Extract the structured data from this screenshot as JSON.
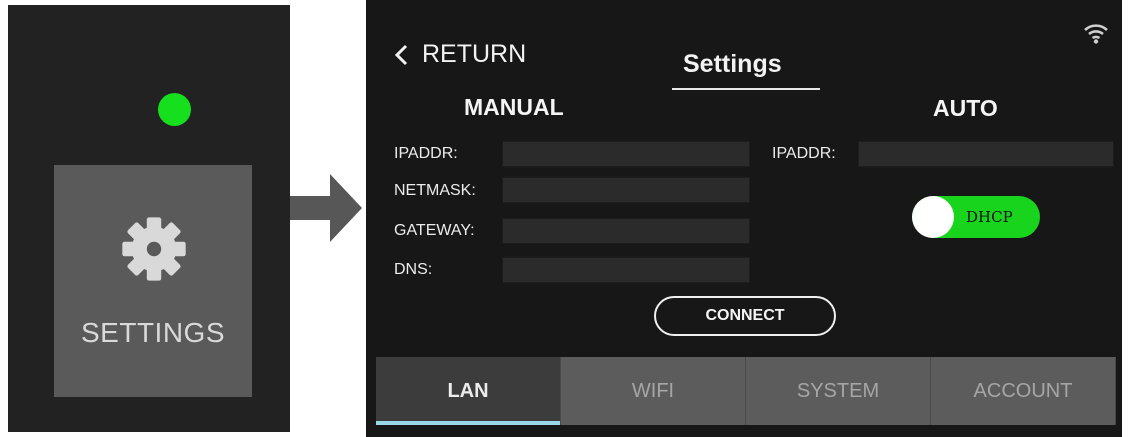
{
  "left_panel": {
    "status_color": "#16e01e",
    "tile_label": "SETTINGS",
    "tile_icon": "gear-icon"
  },
  "arrow_icon": "arrow-right-icon",
  "settings_screen": {
    "return_label": "RETURN",
    "title": "Settings",
    "status_icon": "wifi-icon",
    "manual": {
      "title": "MANUAL",
      "fields": [
        {
          "label": "IPADDR:",
          "value": ""
        },
        {
          "label": "NETMASK:",
          "value": ""
        },
        {
          "label": "GATEWAY:",
          "value": ""
        },
        {
          "label": "DNS:",
          "value": ""
        }
      ]
    },
    "auto": {
      "title": "AUTO",
      "ip_label": "IPADDR:",
      "ip_value": "",
      "dhcp_label": "DHCP",
      "dhcp_on": true
    },
    "connect_label": "CONNECT",
    "tabs": [
      {
        "label": "LAN",
        "active": true
      },
      {
        "label": "WIFI",
        "active": false
      },
      {
        "label": "SYSTEM",
        "active": false
      },
      {
        "label": "ACCOUNT",
        "active": false
      }
    ],
    "colors": {
      "accent_green": "#18d41c",
      "active_tab_indicator": "#9ad8e8"
    }
  }
}
